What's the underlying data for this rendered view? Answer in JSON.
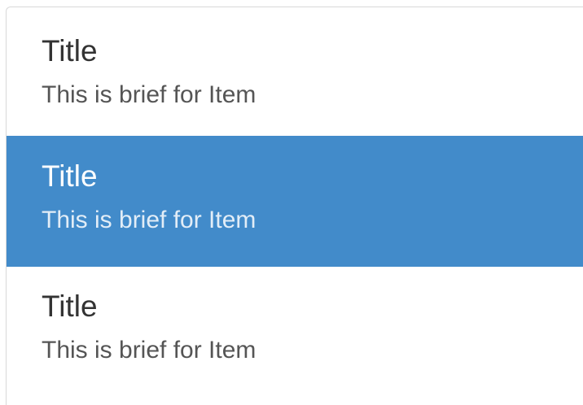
{
  "list": {
    "items": [
      {
        "title": "Title",
        "brief": "This is brief for Item",
        "active": false
      },
      {
        "title": "Title",
        "brief": "This is brief for Item",
        "active": true
      },
      {
        "title": "Title",
        "brief": "This is brief for Item",
        "active": false
      }
    ]
  },
  "colors": {
    "active_background": "#428bca",
    "active_text": "#ffffff",
    "title_text": "#333333",
    "brief_text": "#555555",
    "border": "#d9d9d9"
  }
}
